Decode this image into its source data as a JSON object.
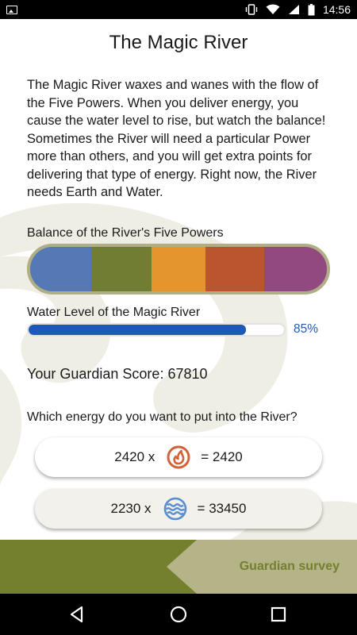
{
  "status_bar": {
    "time": "14:56",
    "left_icons": [
      "image-icon"
    ],
    "right_icons": [
      "vibrate-icon",
      "wifi-icon",
      "signal-icon",
      "battery-icon"
    ]
  },
  "page": {
    "title": "The Magic River",
    "intro": "The Magic River waxes and wanes with the flow of the Five Powers. When you deliver energy, you cause the water level to rise, but watch the balance! Sometimes the River will need a particular Power more than others, and you will get extra points for delivering that type of energy. Right now, the River needs Earth and Water."
  },
  "balance": {
    "label": "Balance of the River's Five Powers",
    "segments": [
      {
        "color": "#5579b4",
        "fraction": 0.205
      },
      {
        "color": "#707d33",
        "fraction": 0.205
      },
      {
        "color": "#e4952e",
        "fraction": 0.18
      },
      {
        "color": "#bb5530",
        "fraction": 0.2
      },
      {
        "color": "#91497f",
        "fraction": 0.21
      }
    ]
  },
  "water_level": {
    "label": "Water Level of the Magic River",
    "percent": 85,
    "percent_text": "85%",
    "fill_color": "#1f59b8"
  },
  "score": {
    "text": "Your Guardian Score: 67810"
  },
  "question": "Which energy do you want to put into the River?",
  "energy_options": [
    {
      "quantity": "2420 x",
      "icon": "fire-energy-icon",
      "result": "= 2420"
    },
    {
      "quantity": "2230 x",
      "icon": "water-energy-icon",
      "result": "= 33450"
    }
  ],
  "footer": {
    "survey_label": "Guardian survey"
  },
  "nav": {
    "icons": [
      "back-icon",
      "home-icon",
      "recents-icon"
    ]
  }
}
